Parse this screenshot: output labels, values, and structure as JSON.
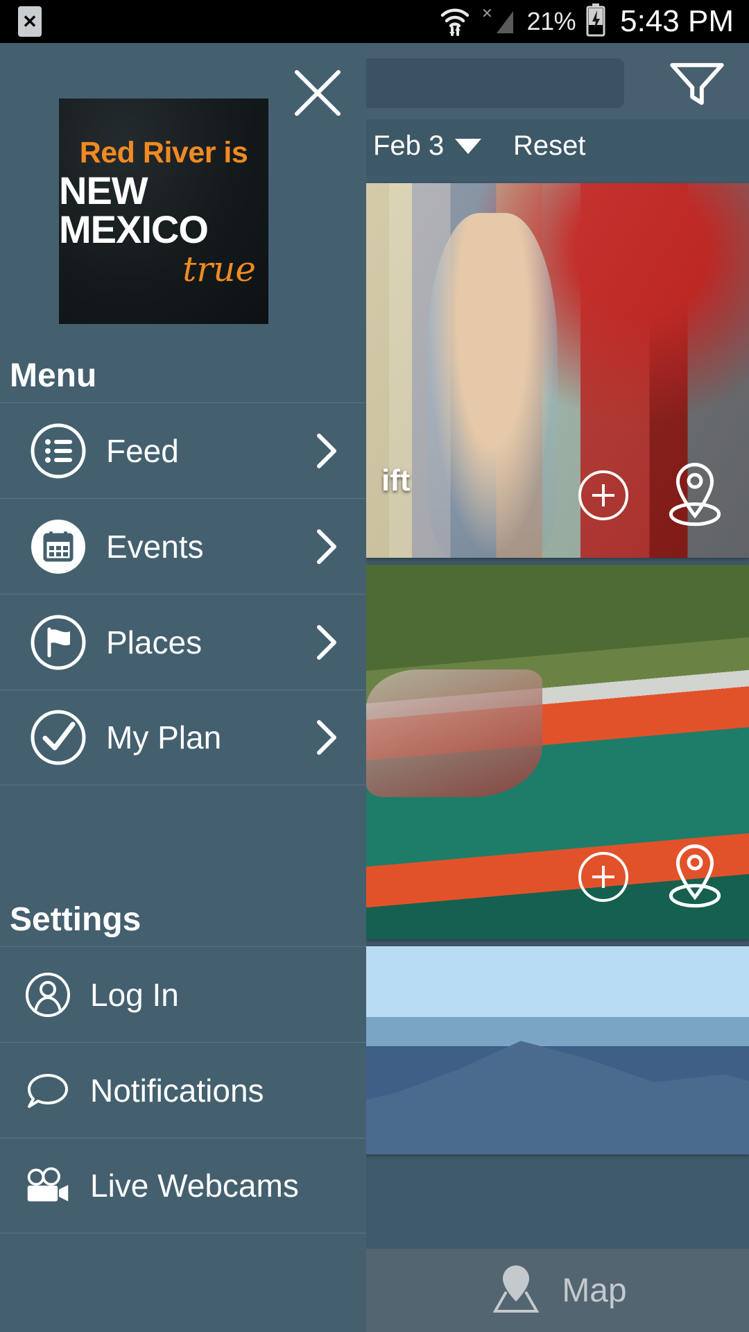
{
  "status_bar": {
    "notification_icon": "sd-card-error-icon",
    "notification_glyph": "✕",
    "wifi_icon": "wifi-icon",
    "signal_icon": "cellular-signal-icon",
    "signal_x_glyph": "✕",
    "battery_percent": "21%",
    "battery_icon": "battery-charging-icon",
    "time": "5:43 PM"
  },
  "drawer": {
    "close_icon": "close-icon",
    "logo": {
      "line1": "Red River is",
      "line2": "NEW MEXICO",
      "line3": "true",
      "accent_color": "#f18a21",
      "background_color": "#141a1c"
    },
    "menu": {
      "title": "Menu",
      "items": [
        {
          "label": "Feed",
          "icon": "list-circle-icon",
          "chevron": "chevron-right-icon",
          "style": "outline"
        },
        {
          "label": "Events",
          "icon": "calendar-circle-icon",
          "chevron": "chevron-right-icon",
          "style": "filled"
        },
        {
          "label": "Places",
          "icon": "flag-circle-icon",
          "chevron": "chevron-right-icon",
          "style": "outline"
        },
        {
          "label": "My Plan",
          "icon": "check-circle-icon",
          "chevron": "chevron-right-icon",
          "style": "outline"
        }
      ]
    },
    "settings": {
      "title": "Settings",
      "items": [
        {
          "label": "Log In",
          "icon": "user-circle-icon"
        },
        {
          "label": "Notifications",
          "icon": "speech-bubble-icon"
        },
        {
          "label": "Live Webcams",
          "icon": "movie-camera-icon"
        }
      ]
    },
    "background_color": "#44606f"
  },
  "feed": {
    "search": {
      "placeholder": "",
      "value": ""
    },
    "filter_icon": "filter-funnel-icon",
    "date_label": "Feb 3",
    "date_caret_icon": "caret-down-icon",
    "reset_label": "Reset",
    "cards": [
      {
        "caption": "ift",
        "photo": "woman-holding-child-at-red-tram",
        "add_icon": "plus-circle-icon",
        "pin_icon": "map-pin-icon"
      },
      {
        "caption": "",
        "photo": "people-on-green-slide-with-orange-netting",
        "add_icon": "plus-circle-icon",
        "pin_icon": "map-pin-icon"
      },
      {
        "caption": "",
        "photo": "blue-mountain-landscape",
        "add_icon": "",
        "pin_icon": ""
      }
    ],
    "map_bar": {
      "label": "Map",
      "icon": "map-pin-location-icon"
    }
  }
}
